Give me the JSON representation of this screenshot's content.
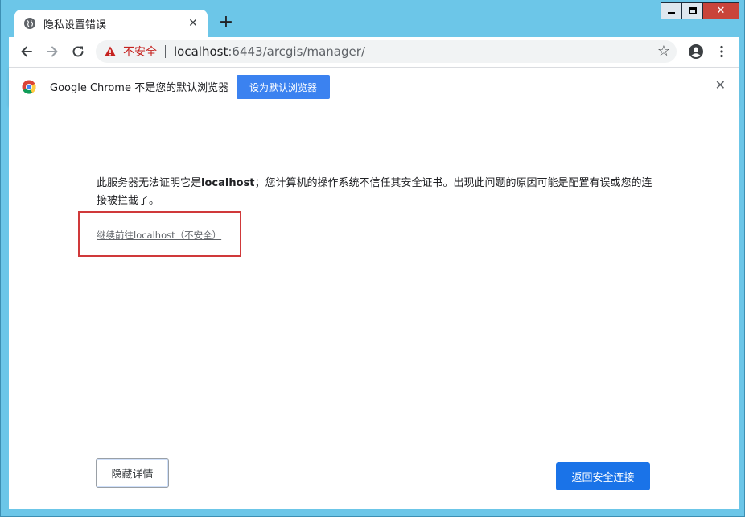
{
  "window": {
    "controls": {
      "minimize": "",
      "maximize": "",
      "close": "✕"
    }
  },
  "tab": {
    "title": "隐私设置错误",
    "close": "✕",
    "new_tab": "+"
  },
  "toolbar": {
    "security_label": "不安全",
    "url_host": "localhost",
    "url_rest": ":6443/arcgis/manager/"
  },
  "infobar": {
    "message": "Google Chrome 不是您的默认浏览器",
    "button_label": "设为默认浏览器",
    "close": "✕"
  },
  "content": {
    "message_pre": "此服务器无法证明它是",
    "message_host": "localhost",
    "message_post": "；您计算机的操作系统不信任其安全证书。出现此问题的原因可能是配置有误或您的连接被拦截了。",
    "proceed_link": "继续前往localhost（不安全）",
    "hide_details_label": "隐藏详情",
    "back_to_safety_label": "返回安全连接"
  },
  "colors": {
    "not_secure": "#c5221f",
    "primary_button": "#1a73e8",
    "highlight": "#d0393a"
  }
}
